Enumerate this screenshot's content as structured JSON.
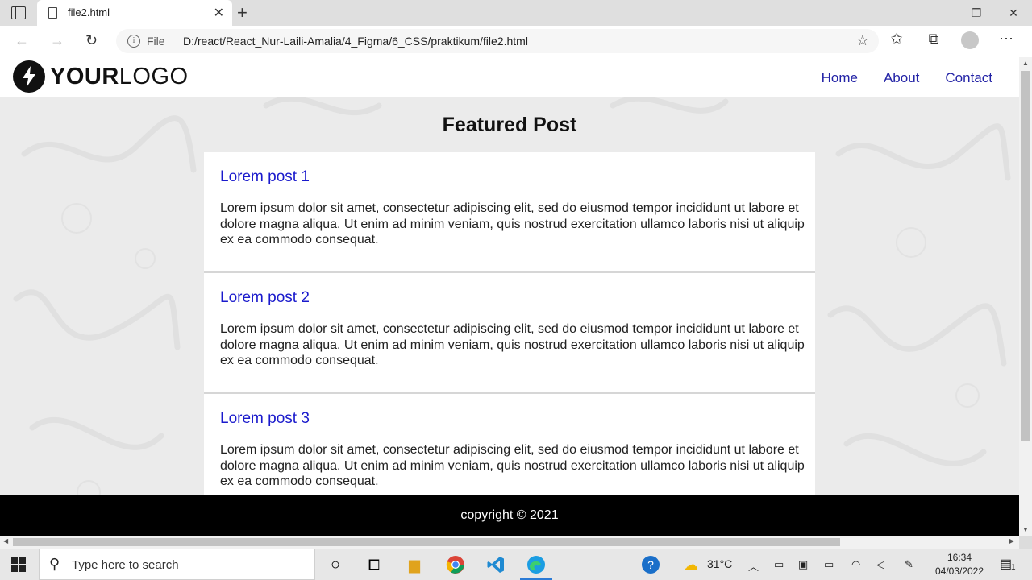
{
  "browser": {
    "tab_title": "file2.html",
    "url_scheme": "File",
    "url": "D:/react/React_Nur-Laili-Amalia/4_Figma/6_CSS/praktikum/file2.html"
  },
  "site": {
    "logo_bold": "YOUR",
    "logo_light": "LOGO",
    "nav": [
      {
        "label": "Home"
      },
      {
        "label": "About"
      },
      {
        "label": "Contact"
      }
    ],
    "section_title": "Featured Post",
    "posts": [
      {
        "title": "Lorem post 1",
        "body": "Lorem ipsum dolor sit amet, consectetur adipiscing elit, sed do eiusmod tempor incididunt ut labore et dolore magna aliqua. Ut enim ad minim veniam, quis nostrud exercitation ullamco laboris nisi ut aliquip ex ea commodo consequat."
      },
      {
        "title": "Lorem post 2",
        "body": "Lorem ipsum dolor sit amet, consectetur adipiscing elit, sed do eiusmod tempor incididunt ut labore et dolore magna aliqua. Ut enim ad minim veniam, quis nostrud exercitation ullamco laboris nisi ut aliquip ex ea commodo consequat."
      },
      {
        "title": "Lorem post 3",
        "body": "Lorem ipsum dolor sit amet, consectetur adipiscing elit, sed do eiusmod tempor incididunt ut labore et dolore magna aliqua. Ut enim ad minim veniam, quis nostrud exercitation ullamco laboris nisi ut aliquip ex ea commodo consequat."
      }
    ],
    "footer": "copyright © 2021"
  },
  "taskbar": {
    "search_placeholder": "Type here to search",
    "temperature": "31°C",
    "time": "16:34",
    "date": "04/03/2022",
    "notification_count": "1"
  },
  "colors": {
    "nav_link": "#2323a6",
    "post_title": "#1a1acc",
    "footer_bg": "#000000",
    "page_bg": "#ebebeb"
  },
  "icons": [
    "tab-actions-icon",
    "page-icon",
    "close-icon",
    "plus-icon",
    "minimize-icon",
    "maximize-icon",
    "back-icon",
    "forward-icon",
    "reload-icon",
    "info-icon",
    "add-favorite-icon",
    "favorites-icon",
    "collections-icon",
    "profile-icon",
    "more-icon",
    "lightning-logo-icon",
    "windows-start-icon",
    "search-icon",
    "cortana-icon",
    "task-view-icon",
    "file-explorer-icon",
    "chrome-icon",
    "vscode-icon",
    "edge-icon",
    "help-icon",
    "weather-icon"
  ]
}
